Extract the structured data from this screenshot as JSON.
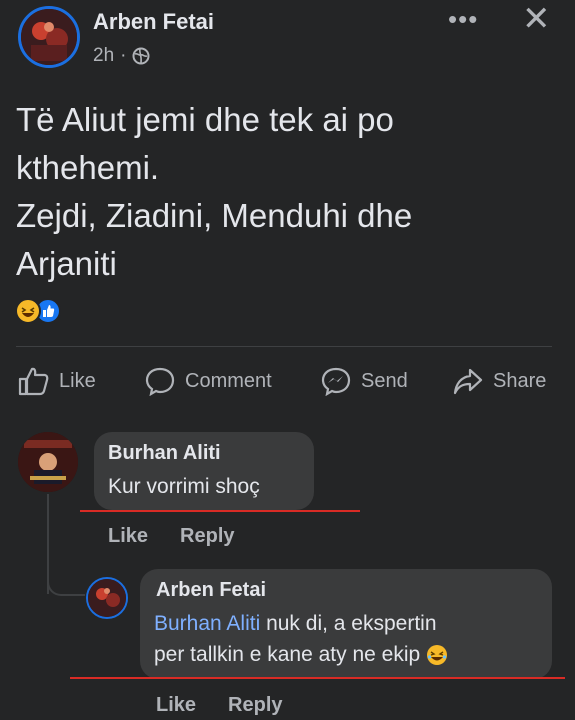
{
  "post": {
    "author": "Arben Fetai",
    "time": "2h",
    "privacy_icon": "globe-icon",
    "lines": [
      "Të Aliut jemi dhe tek ai po",
      "kthehemi.",
      "Zejdi, Ziadini, Menduhi dhe",
      "Arjaniti"
    ],
    "reactions": [
      "haha",
      "like"
    ]
  },
  "header": {
    "more": "•••",
    "close": "✕"
  },
  "actions": {
    "like": "Like",
    "comment": "Comment",
    "send": "Send",
    "share": "Share"
  },
  "comments": [
    {
      "author": "Burhan Aliti",
      "text": "Kur vorrimi shoç",
      "like": "Like",
      "reply": "Reply"
    },
    {
      "author": "Arben Fetai",
      "mention": "Burhan Aliti",
      "text_line1": " nuk di, a ekspertin",
      "text_line2": "per tallkin e kane aty ne ekip",
      "like": "Like",
      "reply": "Reply"
    }
  ],
  "colors": {
    "background": "#242526",
    "accent_blue": "#1b6fe0",
    "mention": "#7fb0ff",
    "underline_red": "#d92b25"
  }
}
